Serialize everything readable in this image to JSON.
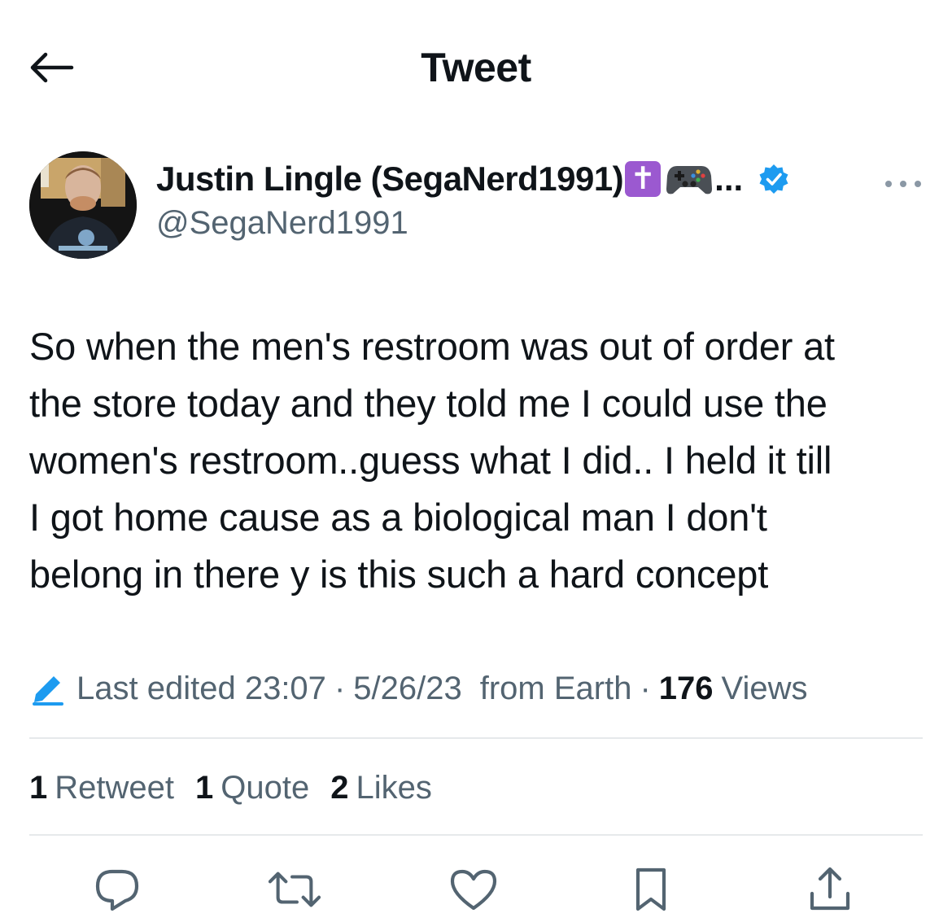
{
  "header": {
    "title": "Tweet",
    "back_icon": "arrow-left-icon"
  },
  "author": {
    "display_name": "Justin Lingle (SegaNerd1991)",
    "name_emoji_1": "✝",
    "name_emoji_2_icon": "video-game-controller-icon",
    "name_truncation": "...",
    "verified_icon": "verified-badge-icon",
    "handle": "@SegaNerd1991",
    "more_icon": "more-options-icon"
  },
  "tweet": {
    "lines": [
      "So when the men's restroom was out of order at",
      "the store today and they told me I could use the",
      "women's restroom..guess what I did.. I held it till",
      "I got home cause as a biological man I don't",
      "belong in there y is this such a hard concept"
    ]
  },
  "meta": {
    "edit_label": "Last edited",
    "time": "23:07",
    "separator": "·",
    "date": "5/26/23",
    "source": "from Earth",
    "views_count": "176",
    "views_label": "Views"
  },
  "stats": [
    {
      "count": "1",
      "label": "Retweet"
    },
    {
      "count": "1",
      "label": "Quote"
    },
    {
      "count": "2",
      "label": "Likes"
    }
  ],
  "actions": [
    {
      "name": "reply",
      "icon": "reply-icon"
    },
    {
      "name": "retweet",
      "icon": "retweet-icon"
    },
    {
      "name": "like",
      "icon": "heart-icon"
    },
    {
      "name": "bookmark",
      "icon": "bookmark-icon"
    },
    {
      "name": "share",
      "icon": "share-icon"
    }
  ],
  "colors": {
    "text_primary": "#0f1419",
    "text_secondary": "#536471",
    "verified_blue": "#1d9bf0",
    "divider": "#e6e9eb",
    "cross_emoji_bg": "#9b59d0"
  }
}
